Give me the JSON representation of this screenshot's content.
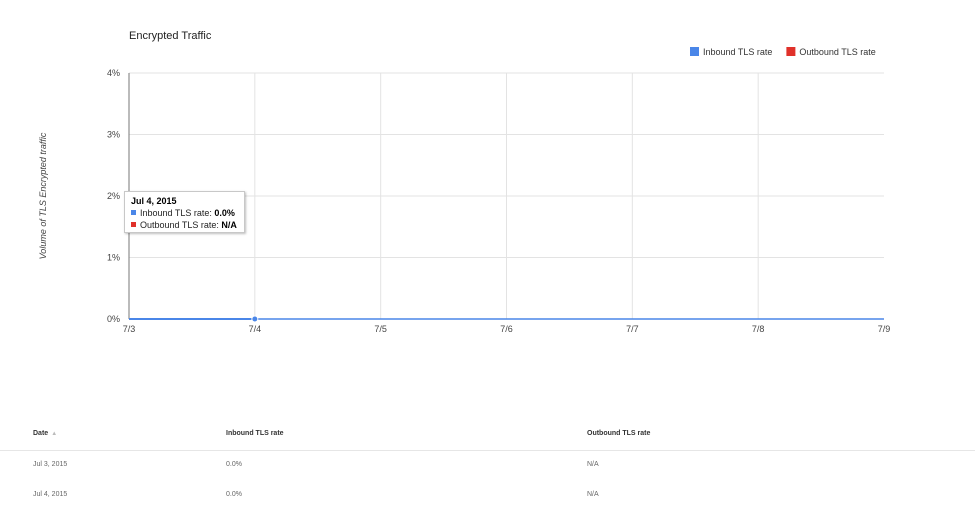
{
  "chart_data": {
    "type": "line",
    "title": "Encrypted Traffic",
    "ylabel": "Volume of TLS Encrypted traffic",
    "xlabel": "",
    "x": [
      "7/3",
      "7/4",
      "7/5",
      "7/6",
      "7/7",
      "7/8",
      "7/9"
    ],
    "y_ticks": [
      "0%",
      "1%",
      "2%",
      "3%",
      "4%"
    ],
    "ylim": [
      0,
      4
    ],
    "grid": true,
    "legend_position": "top-right",
    "series": [
      {
        "name": "Inbound TLS rate",
        "color": "#4a86e8",
        "x": [
          "7/3",
          "7/4"
        ],
        "values": [
          0.0,
          0.0
        ]
      },
      {
        "name": "Outbound TLS rate",
        "color": "#e0312a",
        "x": [],
        "values": []
      }
    ]
  },
  "tooltip": {
    "date": "Jul 4, 2015",
    "rows": [
      {
        "label": "Inbound TLS rate: ",
        "value": "0.0%",
        "color": "#4a86e8"
      },
      {
        "label": "Outbound TLS rate: ",
        "value": "N/A",
        "color": "#e0312a"
      }
    ]
  },
  "table": {
    "sort_icon": "sort-arrow-icon",
    "headers": [
      "Date",
      "Inbound TLS rate",
      "Outbound TLS rate"
    ],
    "rows": [
      [
        "Jul 3, 2015",
        "0.0%",
        "N/A"
      ],
      [
        "Jul 4, 2015",
        "0.0%",
        "N/A"
      ]
    ]
  }
}
